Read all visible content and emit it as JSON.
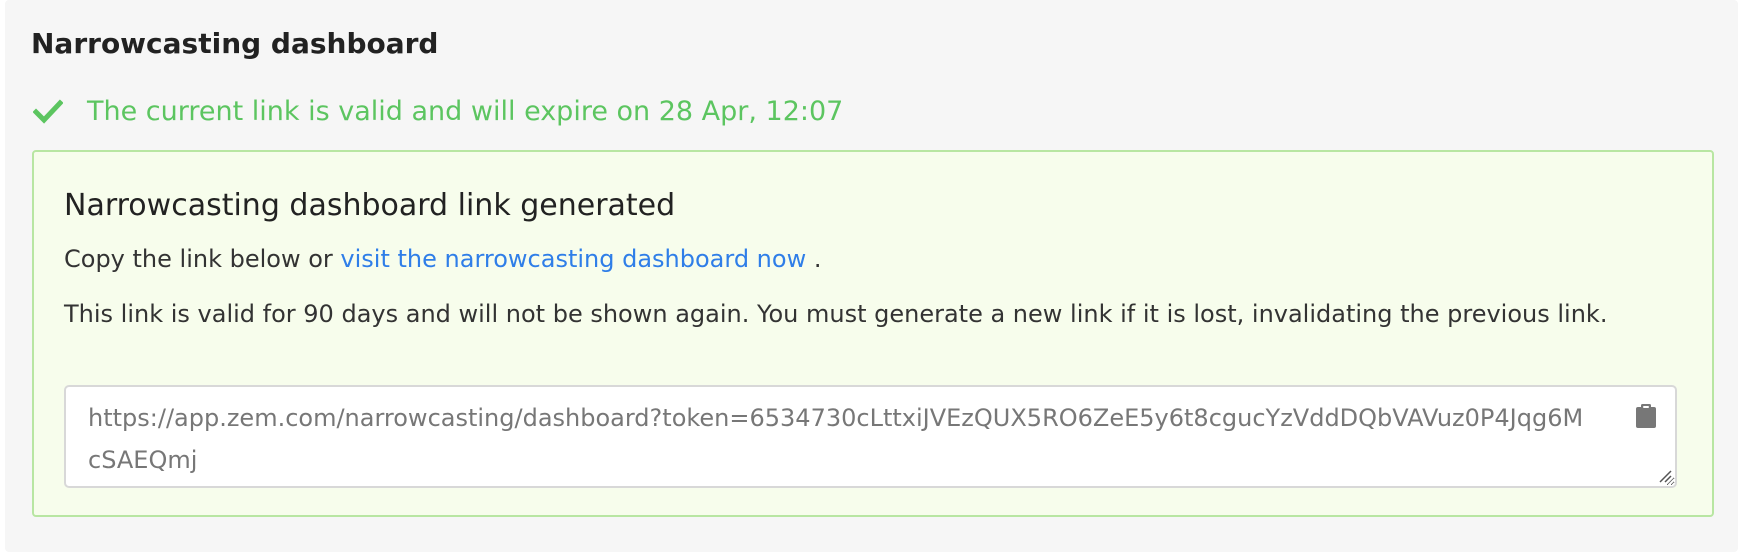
{
  "panel": {
    "title": "Narrowcasting dashboard"
  },
  "status": {
    "icon": "check-icon",
    "text": "The current link is valid and will expire on 28 Apr, 12:07",
    "color": "#5cc560"
  },
  "success_box": {
    "heading": "Narrowcasting dashboard link generated",
    "copy_prefix": "Copy the link below",
    "copy_or": "or",
    "visit_link_label": "visit the narrowcasting dashboard now",
    "copy_suffix": ".",
    "validity_text": "This link is valid for 90 days and will not be shown again. You must generate a new link if it is lost, invalidating the previous link.",
    "link_value": "https://app.zem.com/narrowcasting/dashboard?token=6534730cLttxiJVEzQUX5RO6ZeE5y6t8cgucYzVddDQbVAVuz0P4Jqg6McSAEQmj",
    "copy_icon": "clipboard-icon",
    "background": "#f7fdec",
    "border": "#b8e6a2",
    "link_color": "#2f7ee8"
  }
}
